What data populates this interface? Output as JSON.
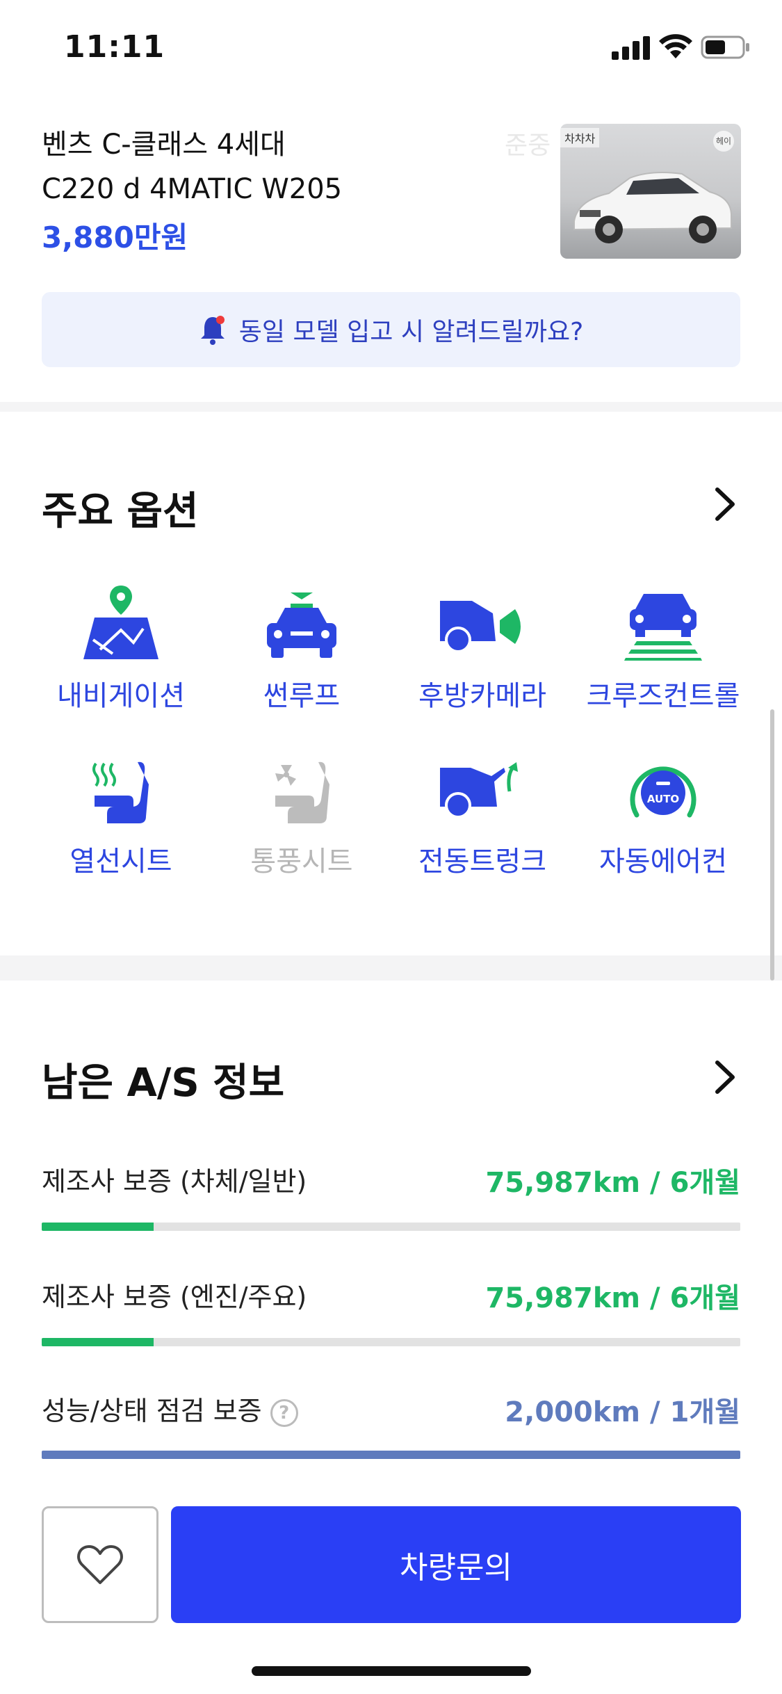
{
  "status_bar": {
    "time": "11:11"
  },
  "car": {
    "title_line1": "벤츠 C-클래스 4세대",
    "title_line2": "C220 d 4MATIC W205",
    "price": "3,880만원",
    "thumb_badge": "차차차",
    "thumb_corner": "헤이"
  },
  "alert": {
    "text": "동일 모델 입고 시 알려드릴까요?"
  },
  "options": {
    "title": "주요 옵션",
    "items": [
      {
        "label": "내비게이션",
        "icon": "navigation-icon",
        "active": true
      },
      {
        "label": "썬루프",
        "icon": "sunroof-icon",
        "active": true
      },
      {
        "label": "후방카메라",
        "icon": "rear-camera-icon",
        "active": true
      },
      {
        "label": "크루즈컨트롤",
        "icon": "cruise-control-icon",
        "active": true
      },
      {
        "label": "열선시트",
        "icon": "heated-seat-icon",
        "active": true
      },
      {
        "label": "통풍시트",
        "icon": "ventilated-seat-icon",
        "active": false
      },
      {
        "label": "전동트렁크",
        "icon": "power-trunk-icon",
        "active": true
      },
      {
        "label": "자동에어컨",
        "icon": "auto-aircon-icon",
        "active": true,
        "badge": "AUTO"
      }
    ]
  },
  "as_info": {
    "title": "남은 A/S 정보",
    "rows": [
      {
        "label": "제조사 보증 (차체/일반)",
        "value": "75,987km / 6개월",
        "progress": 0.16,
        "color": "#1eb765"
      },
      {
        "label": "제조사 보증 (엔진/주요)",
        "value": "75,987km / 6개월",
        "progress": 0.16,
        "color": "#1eb765"
      },
      {
        "label": "성능/상태 점검 보증",
        "value": "2,000km / 1개월",
        "progress": 1.0,
        "color": "#5f7bbd"
      }
    ]
  },
  "help_symbol": "?",
  "bottom": {
    "inquire_label": "차량문의"
  },
  "colors": {
    "accent": "#2a3ff5",
    "green": "#1eb765",
    "slate": "#5f7bbd"
  }
}
